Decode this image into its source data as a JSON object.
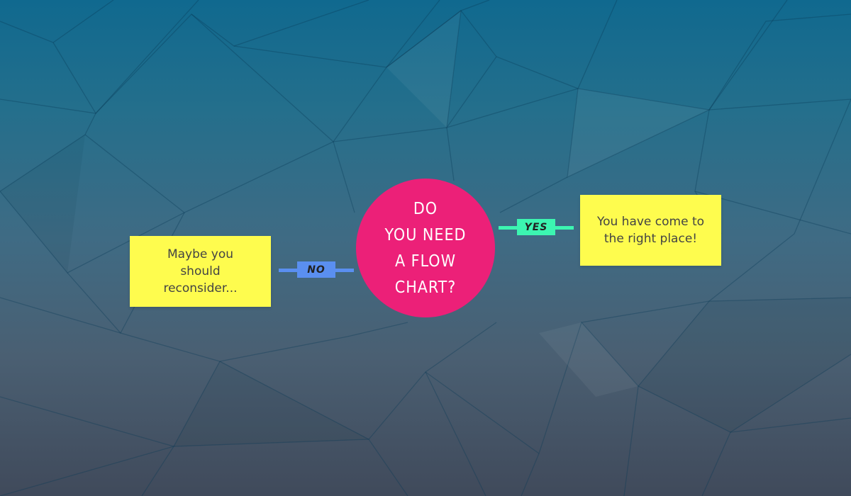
{
  "diagram": {
    "question": "DO\nYOU NEED\nA FLOW\nCHART?",
    "yes_answer": "You have come to the right place!",
    "no_answer": "Maybe you should reconsider...",
    "yes_label": "YES",
    "no_label": "NO"
  },
  "colors": {
    "question_fill": "#ec2078",
    "answer_fill": "#fefc4e",
    "yes_connector": "#3cf5b1",
    "no_connector": "#5a8ff0",
    "background_top": "#10698f",
    "background_bottom": "#404a5b"
  }
}
